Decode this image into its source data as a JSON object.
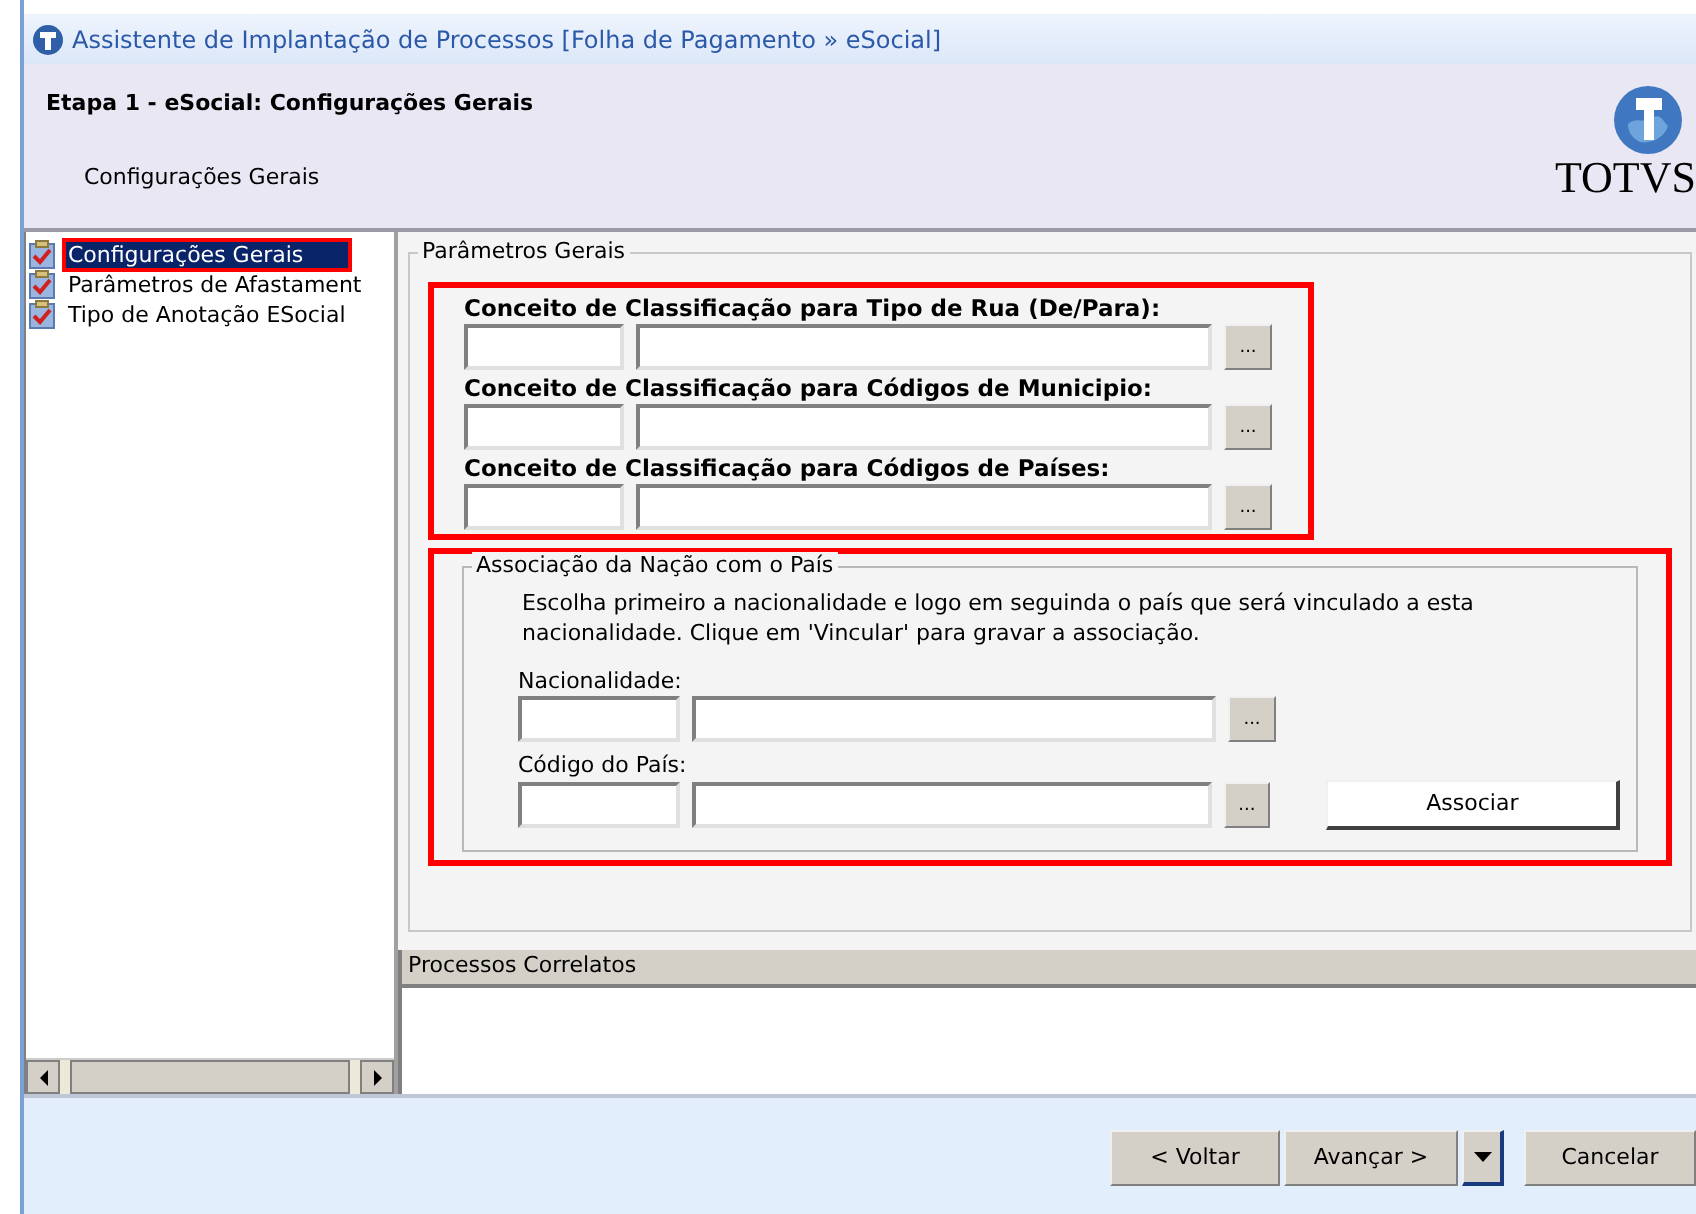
{
  "window": {
    "title": "Assistente de Implantação de Processos [Folha de Pagamento » eSocial]"
  },
  "header": {
    "step_title": "Etapa 1 - eSocial: Configurações Gerais",
    "subtitle": "Configurações Gerais",
    "logo_text": "TOTVS"
  },
  "steps": [
    {
      "label": "Configurações Gerais",
      "selected": true,
      "highlighted": true
    },
    {
      "label": "Parâmetros de Afastament",
      "selected": false,
      "highlighted": false
    },
    {
      "label": "Tipo de Anotação ESocial",
      "selected": false,
      "highlighted": false
    }
  ],
  "general_parameters": {
    "title": "Parâmetros Gerais",
    "highlighted": true,
    "fields": [
      {
        "label": "Conceito de Classificação para Tipo de Rua (De/Para):",
        "lookup_button": "..."
      },
      {
        "label": "Conceito de Classificação para Códigos de Municipio:",
        "lookup_button": "..."
      },
      {
        "label": "Conceito de Classificação para Códigos de Países:",
        "lookup_button": "..."
      }
    ]
  },
  "association": {
    "title": "Associação da Nação com o País",
    "highlighted": true,
    "description": "Escolha primeiro a nacionalidade e logo em seguinda o país que será vinculado a esta nacionalidade. Clique em 'Vincular' para gravar a associação.",
    "fields": [
      {
        "label": "Nacionalidade:",
        "lookup_button": "..."
      },
      {
        "label": "Código do País:",
        "lookup_button": "..."
      }
    ],
    "button": "Associar"
  },
  "related_processes": {
    "title": "Processos Correlatos"
  },
  "buttons": {
    "back": "< Voltar",
    "next": "Avançar >",
    "cancel": "Cancelar"
  }
}
